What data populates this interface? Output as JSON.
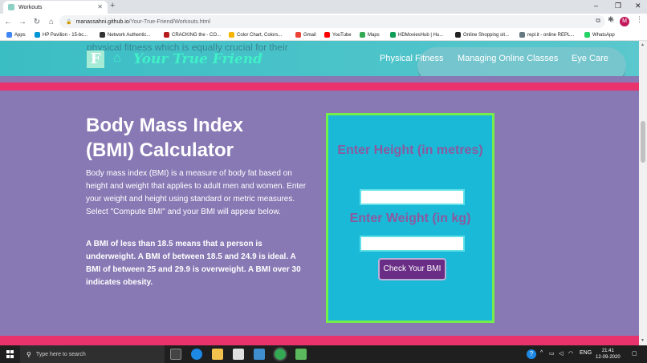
{
  "browser": {
    "tab_title": "Workouts",
    "tab_close": "✕",
    "new_tab": "+",
    "window_controls": {
      "minimize": "–",
      "maximize": "❐",
      "close": "✕"
    },
    "url_domain": "manassahni.github.io",
    "url_path": "/Your-True-Friend/Workouts.html",
    "avatar_initial": "M",
    "bookmarks": [
      {
        "label": "Apps",
        "color": "#4285f4"
      },
      {
        "label": "HP Pavilion - 15-bc...",
        "color": "#0096d6"
      },
      {
        "label": "Network Authentic...",
        "color": "#333333"
      },
      {
        "label": "CRACKING the - CO...",
        "color": "#b71c1c"
      },
      {
        "label": "Color Chart, Colors...",
        "color": "#f4b400"
      },
      {
        "label": "Gmail",
        "color": "#ea4335"
      },
      {
        "label": "YouTube",
        "color": "#ff0000"
      },
      {
        "label": "Maps",
        "color": "#34a853"
      },
      {
        "label": "HDMoviesHub | Hu...",
        "color": "#0f9d58"
      },
      {
        "label": "Online Shopping sit...",
        "color": "#222222"
      },
      {
        "label": "repl.it - online REPL...",
        "color": "#667881"
      },
      {
        "label": "WhatsApp",
        "color": "#25d366"
      }
    ]
  },
  "site": {
    "hero_faded_text": "physical fitness which is equally crucial for their",
    "logo_letter": "F",
    "logo_text": "Your True Friend",
    "nav": [
      "Physical Fitness",
      "Managing Online Classes",
      "Eye Care"
    ]
  },
  "bmi": {
    "title": "Body Mass Index (BMI) Calculator",
    "description": "Body mass index (BMI) is a measure of body fat based on height and weight that applies to adult men and women. Enter your weight and height using standard or metric measures. Select \"Compute BMI\" and your BMI will appear below.",
    "ranges": "A BMI of less than 18.5 means that a person is underweight. A BMI of between 18.5 and 24.9 is ideal. A BMI of between 25 and 29.9 is overweight. A BMI over 30 indicates obesity.",
    "height_label": "Enter Height (in metres)",
    "height_value": "",
    "weight_label": "Enter Weight (in kg)",
    "weight_value": "",
    "button_label": "Check Your BMI"
  },
  "taskbar": {
    "search_placeholder": "Type here to search",
    "language": "ENG",
    "time": "21:41",
    "date": "12-09-2020"
  }
}
